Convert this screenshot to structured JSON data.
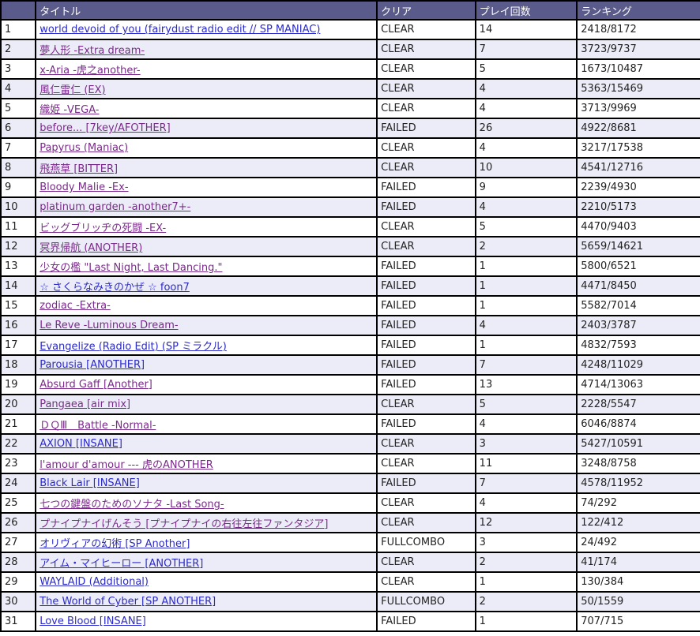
{
  "headers": {
    "num": "",
    "title": "タイトル",
    "clear": "クリア",
    "plays": "プレイ回数",
    "ranking": "ランキング"
  },
  "colors": {
    "header_bg": "#5b5b8b",
    "row_alt_bg": "#ececf8",
    "link": "#2a2ac8",
    "link_visited": "#7a2a8a"
  },
  "rows": [
    {
      "num": "1",
      "title": "world devoid of you (fairydust radio edit // SP MANIAC)",
      "clear": "CLEAR",
      "plays": "14",
      "ranking": "2418/8172",
      "visited": false
    },
    {
      "num": "2",
      "title": "夢人形 -Extra dream-",
      "clear": "CLEAR",
      "plays": "7",
      "ranking": "3723/9737",
      "visited": true
    },
    {
      "num": "3",
      "title": "x-Aria -虎之another-",
      "clear": "CLEAR",
      "plays": "5",
      "ranking": "1673/10487",
      "visited": true
    },
    {
      "num": "4",
      "title": "風仁雷仁 (EX)",
      "clear": "CLEAR",
      "plays": "4",
      "ranking": "5363/15469",
      "visited": true
    },
    {
      "num": "5",
      "title": "織姫 -VEGA-",
      "clear": "CLEAR",
      "plays": "4",
      "ranking": "3713/9969",
      "visited": true
    },
    {
      "num": "6",
      "title": "before... [7key/AFOTHER]",
      "clear": "FAILED",
      "plays": "26",
      "ranking": "4922/8681",
      "visited": true
    },
    {
      "num": "7",
      "title": "Papyrus (Maniac)",
      "clear": "CLEAR",
      "plays": "4",
      "ranking": "3217/17538",
      "visited": true
    },
    {
      "num": "8",
      "title": "飛燕草 [BITTER]",
      "clear": "CLEAR",
      "plays": "10",
      "ranking": "4541/12716",
      "visited": true
    },
    {
      "num": "9",
      "title": "Bloody Malie -Ex-",
      "clear": "FAILED",
      "plays": "9",
      "ranking": "2239/4930",
      "visited": true
    },
    {
      "num": "10",
      "title": "platinum garden -another7+-",
      "clear": "FAILED",
      "plays": "4",
      "ranking": "2210/5173",
      "visited": true
    },
    {
      "num": "11",
      "title": "ビッグブリッヂの死闘 -EX-",
      "clear": "CLEAR",
      "plays": "5",
      "ranking": "4470/9403",
      "visited": true
    },
    {
      "num": "12",
      "title": "冥界帰航 (ANOTHER)",
      "clear": "CLEAR",
      "plays": "2",
      "ranking": "5659/14621",
      "visited": true
    },
    {
      "num": "13",
      "title": "少女の檻 \"Last Night, Last Dancing.\"",
      "clear": "FAILED",
      "plays": "1",
      "ranking": "5800/6521",
      "visited": true
    },
    {
      "num": "14",
      "title": "☆ さくらなみきのかぜ ☆ foon7",
      "clear": "FAILED",
      "plays": "1",
      "ranking": "4471/8450",
      "visited": false
    },
    {
      "num": "15",
      "title": "zodiac -Extra-",
      "clear": "FAILED",
      "plays": "1",
      "ranking": "5582/7014",
      "visited": true
    },
    {
      "num": "16",
      "title": "Le Reve -Luminous Dream-",
      "clear": "FAILED",
      "plays": "4",
      "ranking": "2403/3787",
      "visited": true
    },
    {
      "num": "17",
      "title": "Evangelize (Radio Edit) (SP ミラクル)",
      "clear": "FAILED",
      "plays": "1",
      "ranking": "4832/7593",
      "visited": false
    },
    {
      "num": "18",
      "title": "Parousia [ANOTHER]",
      "clear": "FAILED",
      "plays": "7",
      "ranking": "4248/11029",
      "visited": false
    },
    {
      "num": "19",
      "title": "Absurd Gaff [Another]",
      "clear": "FAILED",
      "plays": "13",
      "ranking": "4714/13063",
      "visited": true
    },
    {
      "num": "20",
      "title": "Pangaea [air mix]",
      "clear": "CLEAR",
      "plays": "5",
      "ranking": "2228/5547",
      "visited": true
    },
    {
      "num": "21",
      "title": "ＤＱⅢ　Battle -Normal-",
      "clear": "FAILED",
      "plays": "4",
      "ranking": "6046/8874",
      "visited": true
    },
    {
      "num": "22",
      "title": "AXION [INSANE]",
      "clear": "CLEAR",
      "plays": "3",
      "ranking": "5427/10591",
      "visited": false
    },
    {
      "num": "23",
      "title": "l'amour d'amour --- 虎のANOTHER",
      "clear": "CLEAR",
      "plays": "11",
      "ranking": "3248/8758",
      "visited": true
    },
    {
      "num": "24",
      "title": "Black Lair [INSANE]",
      "clear": "FAILED",
      "plays": "7",
      "ranking": "4578/11952",
      "visited": false
    },
    {
      "num": "25",
      "title": "七つの鍵盤のためのソナタ -Last Song-",
      "clear": "CLEAR",
      "plays": "4",
      "ranking": "74/292",
      "visited": true
    },
    {
      "num": "26",
      "title": "プナイプナイげんそう [プナイプナイの右往左往ファンタジア]",
      "clear": "CLEAR",
      "plays": "12",
      "ranking": "122/412",
      "visited": true
    },
    {
      "num": "27",
      "title": "オリヴィアの幻術 [SP Another]",
      "clear": "FULLCOMBO",
      "plays": "3",
      "ranking": "24/492",
      "visited": false
    },
    {
      "num": "28",
      "title": "アイム・マイヒーロー [ANOTHER]",
      "clear": "CLEAR",
      "plays": "2",
      "ranking": "41/174",
      "visited": false
    },
    {
      "num": "29",
      "title": "WAYLAID (Additional)",
      "clear": "CLEAR",
      "plays": "1",
      "ranking": "130/384",
      "visited": false
    },
    {
      "num": "30",
      "title": "The World of Cyber [SP ANOTHER]",
      "clear": "FULLCOMBO",
      "plays": "2",
      "ranking": "50/1559",
      "visited": false
    },
    {
      "num": "31",
      "title": "Love Blood [INSANE]",
      "clear": "FAILED",
      "plays": "1",
      "ranking": "707/715",
      "visited": false
    }
  ]
}
